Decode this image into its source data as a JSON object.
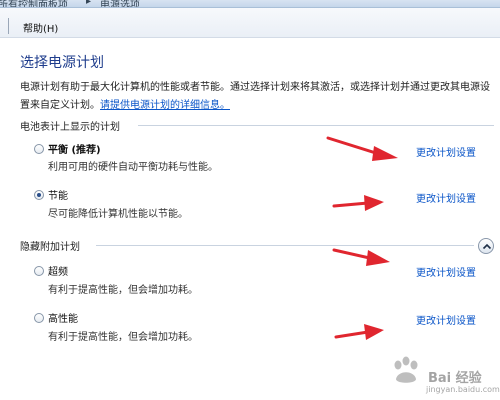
{
  "breadcrumb": {
    "part1": "所有控制面板项",
    "separator": "▸",
    "part2": "电源选项"
  },
  "menu": {
    "help": "帮助(H)"
  },
  "page": {
    "title": "选择电源计划",
    "description": "电源计划有助于最大化计算机的性能或者节能。通过选择计划来将其激活，或选择计划并通过更改其电源设置来自定义计划。",
    "info_link": "请提供电源计划的详细信息。"
  },
  "battery_group": {
    "heading": "电池表计上显示的计划",
    "plans": [
      {
        "name": "平衡 (推荐)",
        "desc": "利用可用的硬件自动平衡功耗与性能。",
        "link": "更改计划设置",
        "selected": false
      },
      {
        "name": "节能",
        "desc": "尽可能降低计算机性能以节能。",
        "link": "更改计划设置",
        "selected": true
      }
    ]
  },
  "hidden_group": {
    "heading": "隐藏附加计划",
    "plans": [
      {
        "name": "超频",
        "desc": "有利于提高性能，但会增加功耗。",
        "link": "更改计划设置",
        "selected": false
      },
      {
        "name": "高性能",
        "desc": "有利于提高性能，但会增加功耗。",
        "link": "更改计划设置",
        "selected": false
      }
    ]
  },
  "watermark": {
    "text": "Bai 经验",
    "sub": "jingyan.baidu.com"
  },
  "colors": {
    "title": "#1e3c8c",
    "link": "#0a55c8",
    "annotation_arrow": "#e0262f"
  }
}
